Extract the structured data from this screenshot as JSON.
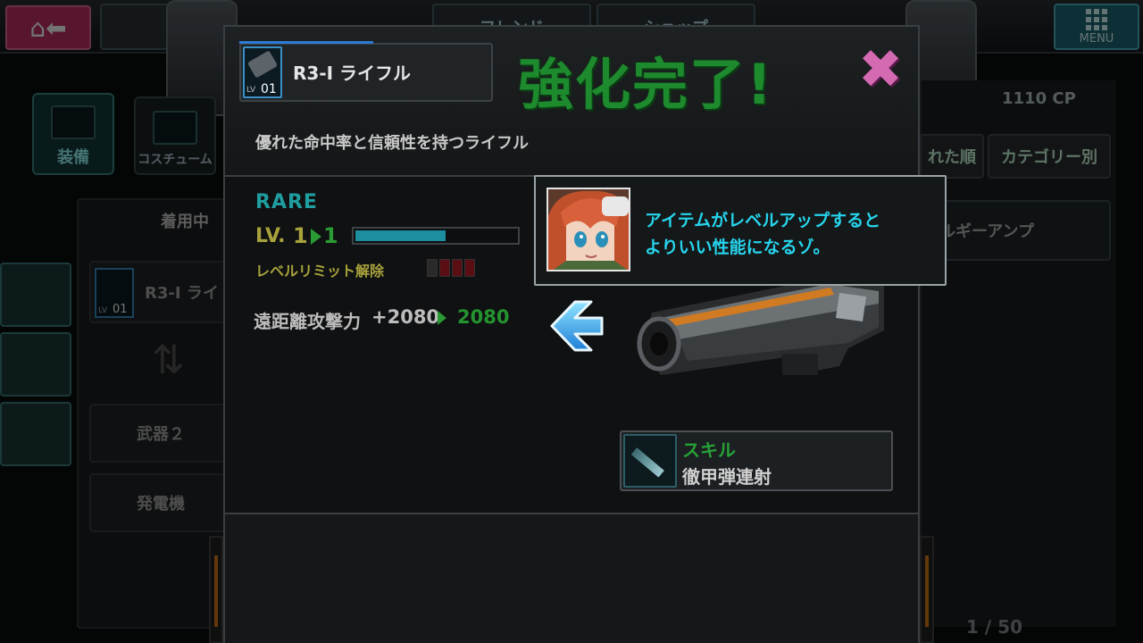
{
  "background": {
    "top_buttons": [
      "フレンド",
      "ショップ"
    ],
    "menu_label": "MENU",
    "side_tabs": [
      "装備",
      "コスチューム"
    ],
    "panel_header": "着用中",
    "slot_item": {
      "name": "R3-I ライ",
      "lv_label": "LV",
      "level": "01"
    },
    "slots": [
      "武器２",
      "発電機"
    ],
    "cp": "1110 CP",
    "sort_buttons": [
      "れた順",
      "カテゴリー別"
    ],
    "list_item": "ルギーアンプ",
    "page_count": "1 / 50"
  },
  "modal": {
    "item": {
      "name": "R3-I ライフル",
      "lv_label": "LV",
      "level": "01"
    },
    "title": "強化完了!",
    "close_symbol": "✖",
    "description": "優れた命中率と信頼性を持つライフル",
    "rarity": "RARE",
    "level": {
      "label": "LV.",
      "from": "1",
      "to": "1",
      "progress": 0.56
    },
    "limit_break": {
      "label": "レベルリミット解除",
      "slots": [
        "#2a2a2a",
        "#5a0e14",
        "#5a0e14",
        "#5a0e14"
      ]
    },
    "stat": {
      "label": "遠距離攻撃力",
      "bonus": "+2080",
      "result": "2080"
    },
    "skill": {
      "label": "スキル",
      "name": "徹甲弾連射"
    }
  },
  "dialog": {
    "lines": [
      "アイテムがレベルアップすると",
      "よりいい性能になるゾ。"
    ]
  },
  "colors": {
    "title_green": "#1e8a2e",
    "dialog_cyan": "#26d4ec",
    "close_pink": "#d46ab2",
    "rarity_teal": "#1f9ea0",
    "level_gold": "#a8a23c"
  }
}
